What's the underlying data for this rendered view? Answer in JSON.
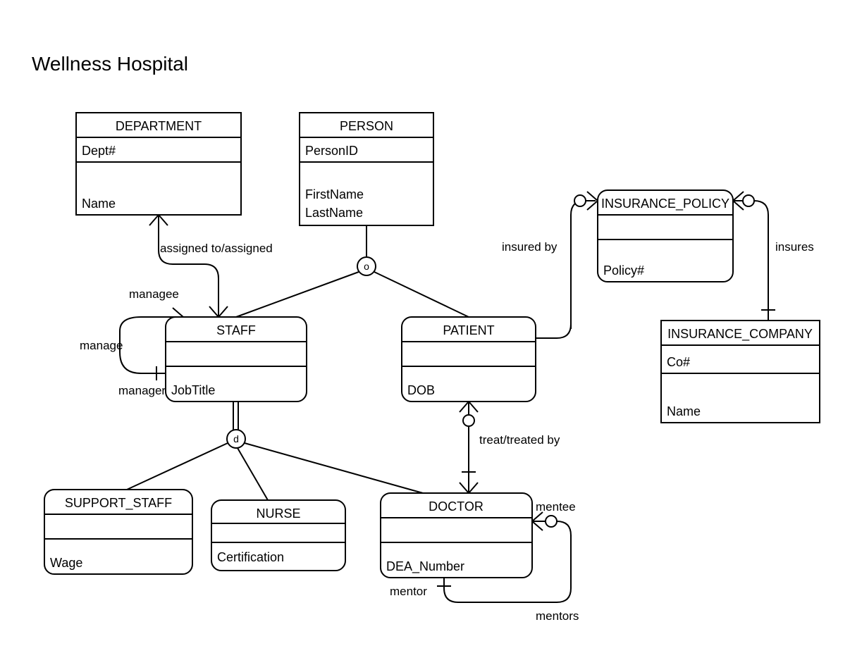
{
  "title": "Wellness Hospital",
  "entities": {
    "department": {
      "name": "DEPARTMENT",
      "keys": [
        "Dept#"
      ],
      "attrs": [
        "Name"
      ]
    },
    "person": {
      "name": "PERSON",
      "keys": [
        "PersonID"
      ],
      "attrs": [
        "FirstName",
        "LastName"
      ]
    },
    "staff": {
      "name": "STAFF",
      "keys": [],
      "attrs": [
        "JobTitle"
      ]
    },
    "patient": {
      "name": "PATIENT",
      "keys": [],
      "attrs": [
        "DOB"
      ]
    },
    "support": {
      "name": "SUPPORT_STAFF",
      "keys": [],
      "attrs": [
        "Wage"
      ]
    },
    "nurse": {
      "name": "NURSE",
      "keys": [],
      "attrs": [
        "Certification"
      ]
    },
    "doctor": {
      "name": "DOCTOR",
      "keys": [],
      "attrs": [
        "DEA_Number"
      ]
    },
    "policy": {
      "name": "INSURANCE_POLICY",
      "keys": [],
      "attrs": [
        "Policy#"
      ]
    },
    "company": {
      "name": "INSURANCE_COMPANY",
      "keys": [
        "Co#"
      ],
      "attrs": [
        "Name"
      ]
    }
  },
  "specializations": {
    "person": "o",
    "staff": "d"
  },
  "relationships": {
    "assigned": "assigned to/assigned",
    "manage": "manage",
    "managee": "managee",
    "manager": "manager",
    "treat": "treat/treated by",
    "insuredby": "insured by",
    "insures": "insures",
    "mentor": "mentor",
    "mentee": "mentee",
    "mentors": "mentors"
  }
}
